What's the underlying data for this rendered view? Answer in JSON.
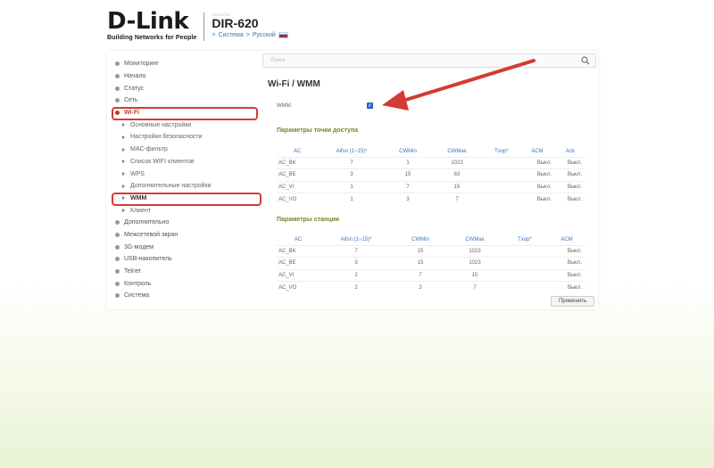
{
  "header": {
    "logo": "D-Link",
    "tagline": "Building Networks for People",
    "model_small": "WIRELESS",
    "model": "DIR-620",
    "crumb_sep1": ">",
    "crumb_system": "Система",
    "crumb_sep2": ">",
    "crumb_lang": "Русский"
  },
  "search": {
    "placeholder": "Поиск"
  },
  "sidebar": {
    "items": [
      {
        "label": "Мониторинг"
      },
      {
        "label": "Начало"
      },
      {
        "label": "Статус"
      },
      {
        "label": "Сеть"
      },
      {
        "label": "Wi-Fi"
      },
      {
        "label": "Дополнительно"
      },
      {
        "label": "Межсетевой экран"
      },
      {
        "label": "3G-модем"
      },
      {
        "label": "USB-накопитель"
      },
      {
        "label": "Telnet"
      },
      {
        "label": "Контроль"
      },
      {
        "label": "Система"
      }
    ],
    "wifi_sub": [
      {
        "label": "Основные настройки"
      },
      {
        "label": "Настройки безопасности"
      },
      {
        "label": "MAC-фильтр"
      },
      {
        "label": "Список WIFI клиентов"
      },
      {
        "label": "WPS"
      },
      {
        "label": "Дополнительные настройки"
      },
      {
        "label": "WMM"
      },
      {
        "label": "Клиент"
      }
    ]
  },
  "main": {
    "title": "Wi-Fi /  WMM",
    "wmm_label": "WMM:",
    "wmm_checked": true,
    "ap_title": "Параметры точки доступа",
    "station_title": "Параметры станции",
    "apply": "Применить"
  },
  "ap_table": {
    "headers": [
      "AC",
      "Aifsn (1~15)*",
      "CWMin",
      "CWMax",
      "Txop*",
      "ACM",
      "Ack"
    ],
    "rows": [
      [
        "AC_BK",
        "7",
        "1",
        "1023",
        "",
        "Выкл.",
        "Выкл."
      ],
      [
        "AC_BE",
        "3",
        "15",
        "63",
        "",
        "Выкл.",
        "Выкл."
      ],
      [
        "AC_VI",
        "1",
        "7",
        "15",
        "",
        "Выкл.",
        "Выкл."
      ],
      [
        "AC_VO",
        "1",
        "3",
        "7",
        "",
        "Выкл.",
        "Выкл."
      ]
    ]
  },
  "station_table": {
    "headers": [
      "AC",
      "Aifsn (1~15)*",
      "CWMin",
      "CWMax",
      "Txop*",
      "ACM"
    ],
    "rows": [
      [
        "AC_BK",
        "7",
        "15",
        "1023",
        "",
        "Выкл."
      ],
      [
        "AC_BE",
        "3",
        "15",
        "1023",
        "",
        "Выкл."
      ],
      [
        "AC_VI",
        "2",
        "7",
        "15",
        "",
        "Выкл."
      ],
      [
        "AC_VO",
        "2",
        "3",
        "7",
        "",
        "Выкл."
      ]
    ]
  },
  "colors": {
    "highlight": "#d23b34",
    "link": "#3a73c4",
    "section": "#6b8a2a",
    "checkbox": "#2f6fd1"
  }
}
